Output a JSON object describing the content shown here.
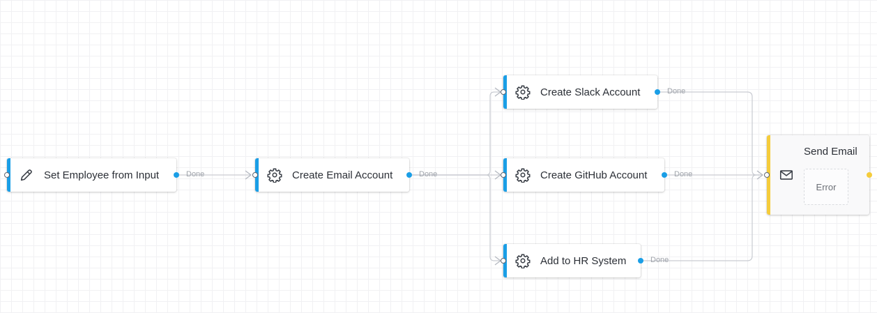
{
  "edge_label": "Done",
  "colors": {
    "step": "#1a9ee6",
    "email": "#f5cc3b",
    "edge": "#c9ccd2"
  },
  "nodes": {
    "set_employee": {
      "label": "Set Employee from Input",
      "icon": "pencil-icon"
    },
    "create_email": {
      "label": "Create Email Account",
      "icon": "gear-icon"
    },
    "create_slack": {
      "label": "Create Slack Account",
      "icon": "gear-icon"
    },
    "create_github": {
      "label": "Create GitHub Account",
      "icon": "gear-icon"
    },
    "add_hr": {
      "label": "Add to HR System",
      "icon": "gear-icon"
    },
    "send_email": {
      "label": "Send Email",
      "icon": "envelope-icon",
      "error_label": "Error"
    }
  },
  "edges": [
    {
      "from": "set_employee",
      "to": "create_email",
      "label": "Done"
    },
    {
      "from": "create_email",
      "to": "create_slack",
      "label": "Done"
    },
    {
      "from": "create_email",
      "to": "create_github",
      "label": "Done"
    },
    {
      "from": "create_email",
      "to": "add_hr",
      "label": "Done"
    },
    {
      "from": "create_slack",
      "to": "send_email",
      "label": "Done"
    },
    {
      "from": "create_github",
      "to": "send_email",
      "label": "Done"
    },
    {
      "from": "add_hr",
      "to": "send_email",
      "label": "Done"
    }
  ]
}
